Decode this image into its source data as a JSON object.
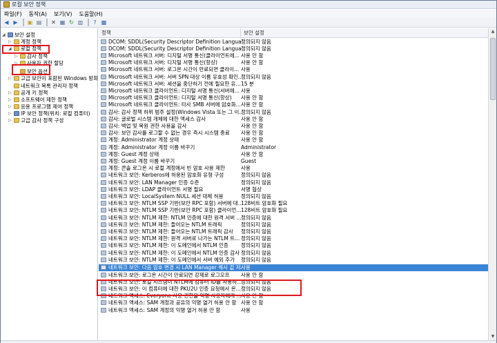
{
  "window": {
    "title": "로컬 보안 정책"
  },
  "menu": [
    "파일(F)",
    "동작(A)",
    "보기(V)",
    "도움말(H)"
  ],
  "toolbar": {
    "icons": [
      "back-icon",
      "forward-icon",
      "up-folder-icon",
      "show-pane-icon",
      "delete-icon",
      "properties-icon",
      "refresh-icon",
      "export-icon",
      "help-icon",
      "mmc-icon"
    ]
  },
  "tree": [
    {
      "label": "보안 설정",
      "level": 0,
      "toggle": "◢",
      "icon": "shield"
    },
    {
      "label": "계정 정책",
      "level": 1,
      "toggle": "▷",
      "icon": "folder"
    },
    {
      "label": "로컬 정책",
      "level": 1,
      "toggle": "◢",
      "icon": "folder"
    },
    {
      "label": "감사 정책",
      "level": 2,
      "toggle": "▷",
      "icon": "folder"
    },
    {
      "label": "사용자 권한 할당",
      "level": 2,
      "toggle": "▷",
      "icon": "folder"
    },
    {
      "label": "보안 옵션",
      "level": 2,
      "toggle": "",
      "icon": "lock"
    },
    {
      "label": "고급 보안이 포함된 Windows 방화벽",
      "level": 1,
      "toggle": "▷",
      "icon": "folder"
    },
    {
      "label": "네트워크 목록 관리자 정책",
      "level": 1,
      "toggle": "",
      "icon": "folder"
    },
    {
      "label": "공개 키 정책",
      "level": 1,
      "toggle": "▷",
      "icon": "folder"
    },
    {
      "label": "소프트웨어 제한 정책",
      "level": 1,
      "toggle": "▷",
      "icon": "folder"
    },
    {
      "label": "응용 프로그램 제어 정책",
      "level": 1,
      "toggle": "▷",
      "icon": "folder"
    },
    {
      "label": "IP 보안 정책(위치: 로컬 컴퓨터)",
      "level": 1,
      "toggle": "▷",
      "icon": "shield"
    },
    {
      "label": "고급 감사 정책 구성",
      "level": 1,
      "toggle": "▷",
      "icon": "folder"
    }
  ],
  "columns": {
    "policy": "정책",
    "setting": "보안 설정"
  },
  "policies": [
    {
      "policy": "DCOM: SDDL(Security Descriptor Definition Language) 구...",
      "setting": "정의되지 않음"
    },
    {
      "policy": "DCOM: SDDL(Security Descriptor Definition Language) 구...",
      "setting": "정의되지 않음"
    },
    {
      "policy": "Microsoft 네트워크 서버: 디지털 서명 통신(클라이언트에...",
      "setting": "사용 안 함"
    },
    {
      "policy": "Microsoft 네트워크 서버: 디지털 서명 통신(항상)",
      "setting": "사용 안 함"
    },
    {
      "policy": "Microsoft 네트워크 서버: 로그온 시간이 만료되면 클라이...",
      "setting": "사용"
    },
    {
      "policy": "Microsoft 네트워크 서버: 서버 SPN 대상 이름 유효성 확인...",
      "setting": "정의되지 않음"
    },
    {
      "policy": "Microsoft 네트워크 서버: 세션을 중단하기 전에 필요한 유...",
      "setting": "15 분"
    },
    {
      "policy": "Microsoft 네트워크 클라이언트: 디지털 서명 통신(서버에...",
      "setting": "사용"
    },
    {
      "policy": "Microsoft 네트워크 클라이언트: 디지털 서명 통신(항상)",
      "setting": "사용 안 함"
    },
    {
      "policy": "Microsoft 네트워크 클라이언트: 타사 SMB 서버에 암호화...",
      "setting": "사용 안 함"
    },
    {
      "policy": "감사: 감사 정책 하위 범주 설정(Windows Vista 또는 그 이...",
      "setting": "정의되지 않음"
    },
    {
      "policy": "감사: 글로벌 시스템 개체에 대한 액세스 감사",
      "setting": "사용 안 함"
    },
    {
      "policy": "감사: 백업 및 복원 권한 사용을 감사",
      "setting": "사용 안 함"
    },
    {
      "policy": "감사: 보안 감사를 로그할 수 없는 경우 즉시 시스템 종료",
      "setting": "사용 안 함"
    },
    {
      "policy": "계정: Administrator 계정 상태",
      "setting": "사용 안 함"
    },
    {
      "policy": "계정: Administrator 계정 이름 바꾸기",
      "setting": "Administrator"
    },
    {
      "policy": "계정: Guest 계정 상태",
      "setting": "사용 안 함"
    },
    {
      "policy": "계정: Guest 계정 이름 바꾸기",
      "setting": "Guest"
    },
    {
      "policy": "계정: 콘솔 로그온 시 로컬 계정에서 빈 암호 사용 제한",
      "setting": "사용"
    },
    {
      "policy": "네트워크 보안: Kerberos에 허용된 암호화 유형 구성",
      "setting": "정의되지 않음"
    },
    {
      "policy": "네트워크 보안: LAN Manager 인증 수준",
      "setting": "정의되지 않음"
    },
    {
      "policy": "네트워크 보안: LDAP 클라이언트 서명 필요",
      "setting": "서명 협상"
    },
    {
      "policy": "네트워크 보안: LocalSystem NULL 세션 대체 허용",
      "setting": "정의되지 않음"
    },
    {
      "policy": "네트워크 보안: NTLM SSP 기반(보안 RPC 포함) 서버에 대...",
      "setting": "128비트 암호화 필요"
    },
    {
      "policy": "네트워크 보안: NTLM SSP 기반(보안 RPC 포함) 클라이언...",
      "setting": "128비트 암호화 필요"
    },
    {
      "policy": "네트워크 보안: NTLM 제한: NTLM 인증에 대한 원격 서버 ...",
      "setting": "정의되지 않음"
    },
    {
      "policy": "네트워크 보안: NTLM 제한: 들어오는 NTLM 트래픽",
      "setting": "정의되지 않음"
    },
    {
      "policy": "네트워크 보안: NTLM 제한: 들어오는 NTLM 트래픽 감사",
      "setting": "정의되지 않음"
    },
    {
      "policy": "네트워크 보안: NTLM 제한: 원격 서버로 나가는 NTLM 트...",
      "setting": "정의되지 않음"
    },
    {
      "policy": "네트워크 보안: NTLM 제한: 이 도메인에서 NTLM 인증",
      "setting": "정의되지 않음"
    },
    {
      "policy": "네트워크 보안: NTLM 제한: 이 도메인에서 NTLM 인증 감사",
      "setting": "정의되지 않음"
    },
    {
      "policy": "네트워크 보안: NTLM 제한: 이 도메인에서 서버 예외 추가",
      "setting": "정의되지 않음"
    },
    {
      "policy": "네트워크 보안: 다음 암호 변경 시 LAN Manager 해시 값 저...",
      "setting": "사용",
      "selected": true
    },
    {
      "policy": "네트워크 보안: 로그온 시간이 만료되면 강제로 로그오프",
      "setting": "사용 안 함"
    },
    {
      "policy": "네트워크 보안: 로컬 시스템이 NTLM에 컴퓨터 ID를 사용하...",
      "setting": "정의되지 않음"
    },
    {
      "policy": "네트워크 보안: 이 컴퓨터에 대한 PKU2U 인증 요청에서 온...",
      "setting": "정의되지 않음"
    },
    {
      "policy": "네트워크 액세스: Everyone 사용 권한을 익명 사용자에게 ...",
      "setting": "사용 안 함"
    },
    {
      "policy": "네트워크 액세스: SAM 계정과 공유의 익명 열거 허용 안 함",
      "setting": "사용 안 함"
    },
    {
      "policy": "네트워크 액세스: SAM 계정의 익명 열거 허용 안 함",
      "setting": "사용"
    }
  ]
}
